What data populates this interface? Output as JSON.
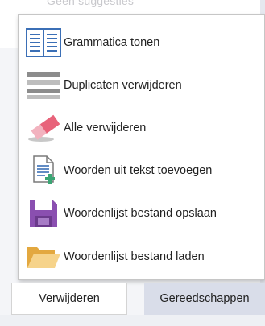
{
  "background": {
    "faded_text": "Geen suggesties"
  },
  "menu": {
    "items": [
      {
        "label": "Grammatica tonen",
        "icon": "book-icon"
      },
      {
        "label": "Duplicaten verwijderen",
        "icon": "duplicate-lines-icon"
      },
      {
        "label": "Alle verwijderen",
        "icon": "eraser-icon"
      },
      {
        "label": "Woorden uit tekst toevoegen",
        "icon": "document-add-icon"
      },
      {
        "label": "Woordenlijst bestand opslaan",
        "icon": "save-disk-icon"
      },
      {
        "label": "Woordenlijst bestand laden",
        "icon": "folder-open-icon"
      }
    ]
  },
  "tabs": {
    "remove": "Verwijderen",
    "tools": "Gereedschappen"
  },
  "colors": {
    "accent_blue": "#3b6fb6",
    "eraser_pink": "#e8637a",
    "disk_purple": "#8a4fb0",
    "folder_yellow": "#f0c36a",
    "add_green": "#3aa574",
    "tools_tab_bg": "#d9dde9"
  }
}
